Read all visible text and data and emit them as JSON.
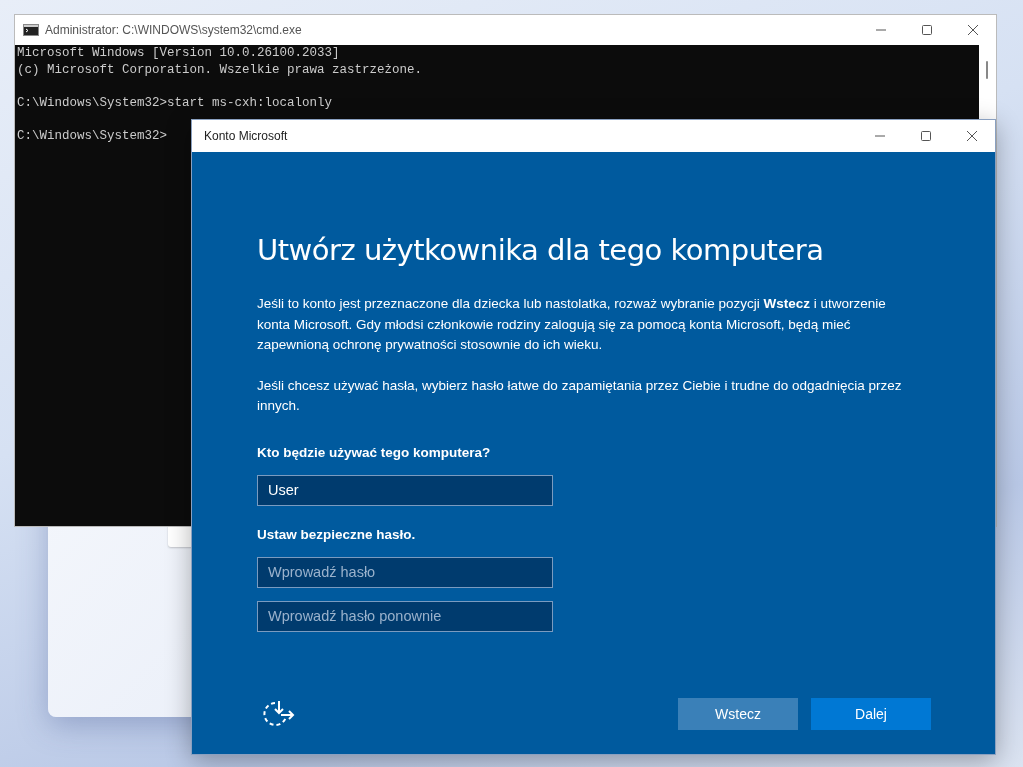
{
  "console_window": {
    "title": "Administrator: C:\\WINDOWS\\system32\\cmd.exe",
    "blocks": [
      [
        "Microsoft Windows [Version 10.0.26100.2033]",
        "(c) Microsoft Corporation. Wszelkie prawa zastrzeżone."
      ],
      [
        "C:\\Windows\\System32>start ms-cxh:localonly"
      ],
      [
        "C:\\Windows\\System32>"
      ]
    ]
  },
  "dialog": {
    "title": "Konto Microsoft",
    "heading": "Utwórz użytkownika dla tego komputera",
    "paragraphs": [
      "Jeśli to konto jest przeznaczone dla dziecka lub nastolatka, rozważ wybranie pozycji **Wstecz** i utworzenie konta Microsoft. Gdy młodsi członkowie rodziny zalogują się za pomocą konta Microsoft, będą mieć zapewnioną ochronę prywatności stosownie do ich wieku.",
      "Jeśli chcesz używać hasła, wybierz hasło łatwe do zapamiętania przez Ciebie i trudne do odgadnięcia przez innych."
    ],
    "form": [
      {
        "kind": "label",
        "text": "Kto będzie używać tego komputera?"
      },
      {
        "kind": "field",
        "value": "User"
      },
      {
        "kind": "label",
        "text": "Ustaw bezpieczne hasło."
      },
      {
        "kind": "field",
        "placeholder": "Wprowadź hasło"
      },
      {
        "kind": "field",
        "placeholder": "Wprowadź hasło ponownie"
      }
    ],
    "buttons": [
      {
        "label": "Wstecz",
        "kind": "secondary"
      },
      {
        "label": "Dalej",
        "kind": "primary"
      }
    ]
  }
}
